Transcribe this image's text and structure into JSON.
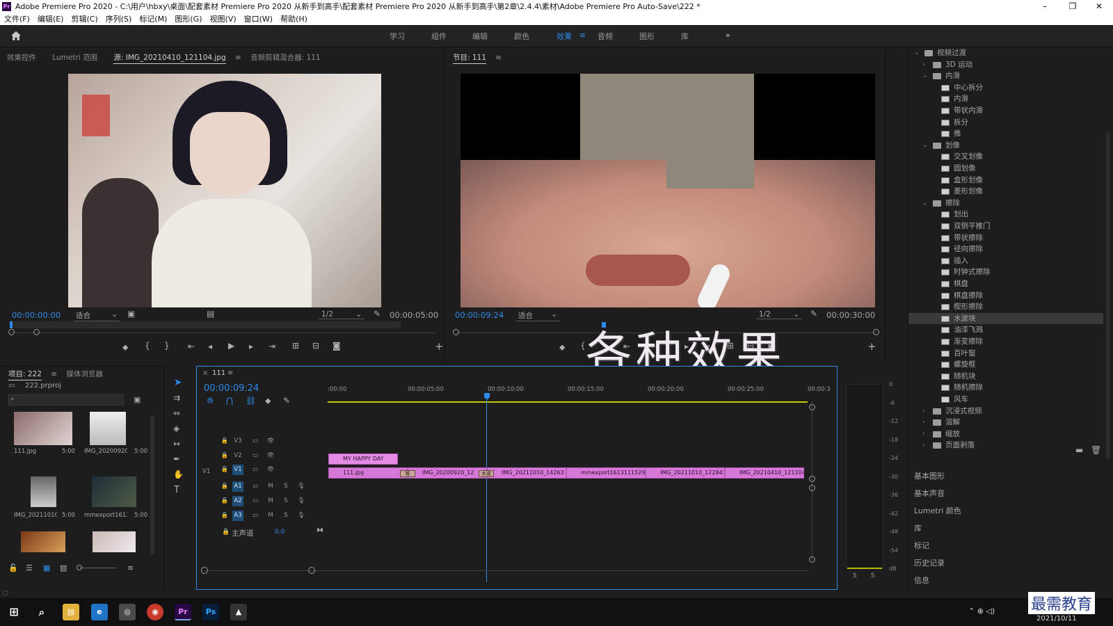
{
  "title_bar": {
    "text": "Adobe Premiere Pro 2020 - C:\\用户\\hbxy\\桌面\\配套素材 Premiere Pro 2020 从新手到高手\\配套素材 Premiere Pro 2020 从新手到高手\\第2章\\2.4.4\\素材\\Adobe Premiere Pro Auto-Save\\222 *",
    "logo": "Pr",
    "minimize": "–",
    "restore": "❐",
    "close": "✕"
  },
  "menu": [
    "文件(F)",
    "编辑(E)",
    "剪辑(C)",
    "序列(S)",
    "标记(M)",
    "图形(G)",
    "视图(V)",
    "窗口(W)",
    "帮助(H)"
  ],
  "workspaces": {
    "items": [
      "学习",
      "组件",
      "编辑",
      "颜色",
      "效果",
      "音频",
      "图形",
      "库"
    ],
    "active": "效果",
    "more": "»"
  },
  "source_panel": {
    "tabs": [
      "效果控件",
      "Lumetri 范围",
      "源: IMG_20210410_121104.jpg",
      "音频剪辑混合器: 111"
    ],
    "active_tab": "源: IMG_20210410_121104.jpg",
    "timecode": "00:00:00:00",
    "fit": "适合",
    "resolution": "1/2",
    "duration": "00:00:05:00"
  },
  "program_panel": {
    "tab": "节目: 111",
    "timecode": "00:00:09:24",
    "fit": "适合",
    "resolution": "1/2",
    "duration": "00:00:30:00"
  },
  "overlay_text": "各种效果",
  "effects_tree": [
    {
      "label": "视频过渡",
      "level": 0,
      "type": "folder",
      "open": true
    },
    {
      "label": "3D 运动",
      "level": 1,
      "type": "folder",
      "open": false
    },
    {
      "label": "内滑",
      "level": 1,
      "type": "folder",
      "open": true
    },
    {
      "label": "中心拆分",
      "level": 2,
      "type": "fx"
    },
    {
      "label": "内滑",
      "level": 2,
      "type": "fx"
    },
    {
      "label": "带状内滑",
      "level": 2,
      "type": "fx"
    },
    {
      "label": "拆分",
      "level": 2,
      "type": "fx"
    },
    {
      "label": "推",
      "level": 2,
      "type": "fx"
    },
    {
      "label": "划像",
      "level": 1,
      "type": "folder",
      "open": true
    },
    {
      "label": "交叉划像",
      "level": 2,
      "type": "fx"
    },
    {
      "label": "圆划像",
      "level": 2,
      "type": "fx"
    },
    {
      "label": "盒形划像",
      "level": 2,
      "type": "fx"
    },
    {
      "label": "菱形划像",
      "level": 2,
      "type": "fx"
    },
    {
      "label": "擦除",
      "level": 1,
      "type": "folder",
      "open": true
    },
    {
      "label": "划出",
      "level": 2,
      "type": "fx"
    },
    {
      "label": "双侧平推门",
      "level": 2,
      "type": "fx"
    },
    {
      "label": "带状擦除",
      "level": 2,
      "type": "fx"
    },
    {
      "label": "径向擦除",
      "level": 2,
      "type": "fx"
    },
    {
      "label": "插入",
      "level": 2,
      "type": "fx"
    },
    {
      "label": "时钟式擦除",
      "level": 2,
      "type": "fx"
    },
    {
      "label": "棋盘",
      "level": 2,
      "type": "fx"
    },
    {
      "label": "棋盘擦除",
      "level": 2,
      "type": "fx"
    },
    {
      "label": "楔形擦除",
      "level": 2,
      "type": "fx"
    },
    {
      "label": "水波块",
      "level": 2,
      "type": "fx",
      "selected": true
    },
    {
      "label": "油漆飞溅",
      "level": 2,
      "type": "fx"
    },
    {
      "label": "渐变擦除",
      "level": 2,
      "type": "fx"
    },
    {
      "label": "百叶窗",
      "level": 2,
      "type": "fx"
    },
    {
      "label": "螺旋框",
      "level": 2,
      "type": "fx"
    },
    {
      "label": "随机块",
      "level": 2,
      "type": "fx"
    },
    {
      "label": "随机擦除",
      "level": 2,
      "type": "fx"
    },
    {
      "label": "风车",
      "level": 2,
      "type": "fx"
    },
    {
      "label": "沉浸式视频",
      "level": 1,
      "type": "folder",
      "open": false
    },
    {
      "label": "溶解",
      "level": 1,
      "type": "folder",
      "open": false
    },
    {
      "label": "缩放",
      "level": 1,
      "type": "folder",
      "open": false
    },
    {
      "label": "页面剥落",
      "level": 1,
      "type": "folder",
      "open": false
    }
  ],
  "side_panels": [
    "基本图形",
    "基本声音",
    "Lumetri 颜色",
    "库",
    "标记",
    "历史记录",
    "信息"
  ],
  "project_panel": {
    "tabs": [
      "项目: 222",
      "媒体浏览器"
    ],
    "file": "222.prproj",
    "items": [
      {
        "name": "111.jpg",
        "duration": "5:00"
      },
      {
        "name": "IMG_20200920_...",
        "duration": "5:00"
      },
      {
        "name": "IMG_20211010_...",
        "duration": "5:00"
      },
      {
        "name": "mmexport16131...",
        "duration": "5:00"
      }
    ]
  },
  "timeline": {
    "tab": "111",
    "timecode": "00:00:09:24",
    "ruler": [
      ":00:00",
      "00:00:05:00",
      "00:00:10:00",
      "00:00:15:00",
      "00:00:20:00",
      "00:00:25:00",
      "00:00:3"
    ],
    "tracks": [
      "V3",
      "V2",
      "V1",
      "A1",
      "A2",
      "A3"
    ],
    "v1_label": "V1",
    "mix_label": "主声道",
    "mix_value": "0.0",
    "track_letters": {
      "m": "M",
      "s": "S"
    },
    "title_clip": "MY HAPPY DAY",
    "clips": [
      "111.jpg",
      "IMG_20200920_12",
      "IMG_20211010_14263",
      "mmexport1613111529447",
      "IMG_20211010_122847.j",
      "IMG_20210410_121104.jp"
    ],
    "transition_labels": [
      "推",
      "水波"
    ]
  },
  "meter": {
    "scale": [
      "0",
      "-6",
      "-12",
      "-18",
      "-24",
      "-30",
      "-36",
      "-42",
      "-48",
      "-54",
      "dB"
    ],
    "solo": [
      "S",
      "S"
    ]
  },
  "taskbar": {
    "date": "2021/10/11",
    "watermark": "最需教育"
  }
}
